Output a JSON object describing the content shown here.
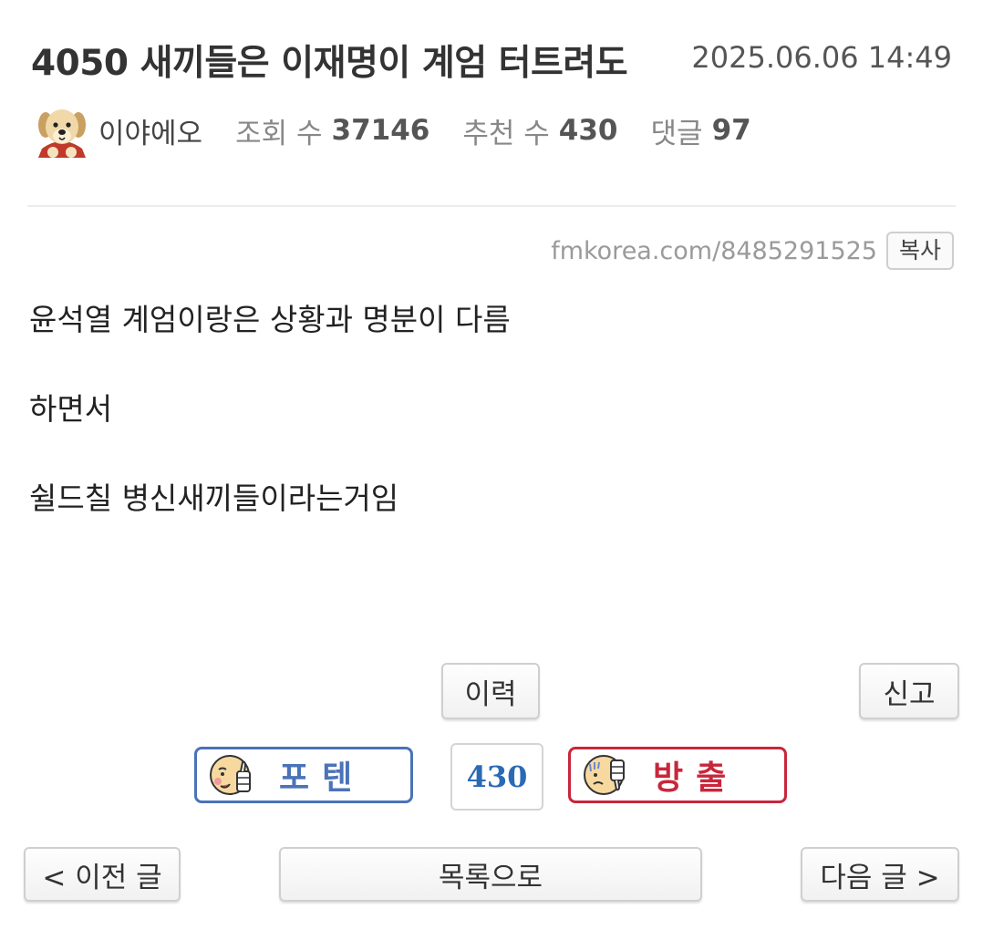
{
  "post": {
    "title": "4050 새끼들은 이재명이 계엄 터트려도",
    "date": "2025.06.06 14:49",
    "author": "이야에오",
    "views_label": "조회 수",
    "views": "37146",
    "recommend_label": "추천 수",
    "recommend": "430",
    "comments_label": "댓글",
    "comments": "97",
    "url": "fmkorea.com/8485291525",
    "copy_label": "복사",
    "body": [
      "윤석열 계엄이랑은 상황과 명분이 다름",
      "하면서",
      "쉴드칠 병신새끼들이라는거임"
    ]
  },
  "actions": {
    "history_label": "이력",
    "report_label": "신고"
  },
  "vote": {
    "up_label": "포텐",
    "up_color": "#4a73b8",
    "count": "430",
    "down_label": "방출",
    "down_color": "#c8263b"
  },
  "nav": {
    "prev_label": "< 이전 글",
    "list_label": "목록으로",
    "next_label": "다음 글 >"
  },
  "icons": {
    "avatar": "puppy-avatar-icon",
    "up": "thumbs-up-face-icon",
    "down": "thumbs-down-face-icon"
  }
}
